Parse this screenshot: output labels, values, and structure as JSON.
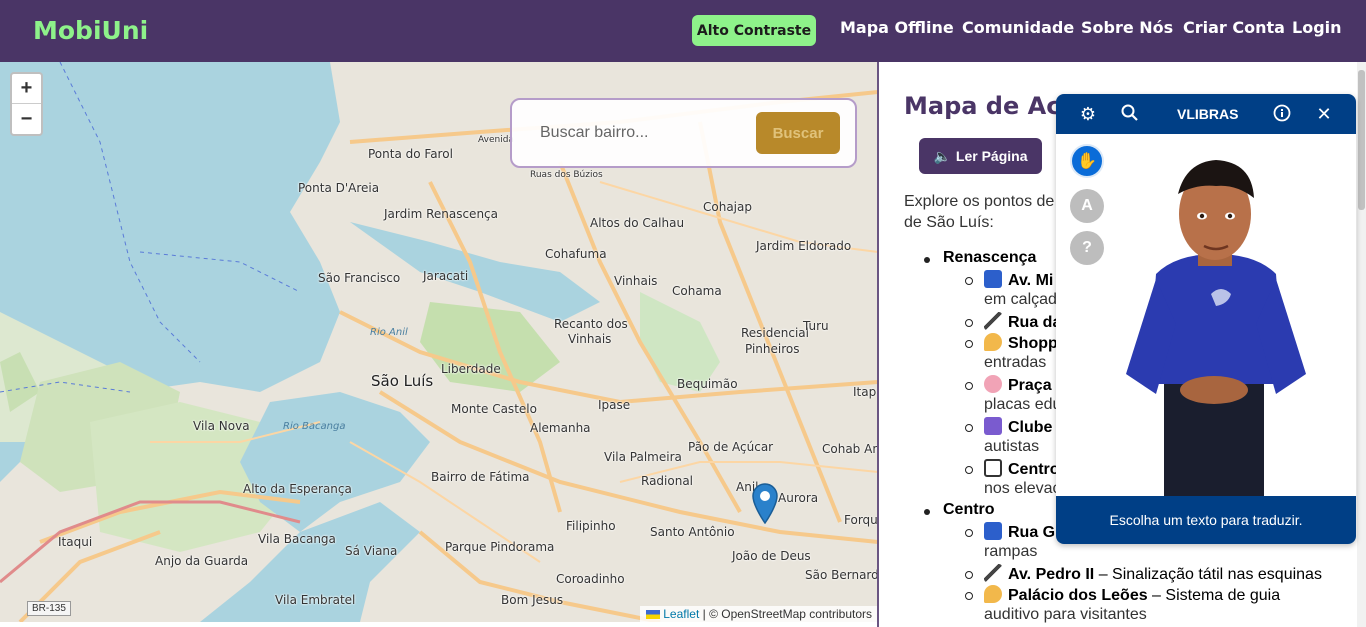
{
  "header": {
    "logo": "MobiUni",
    "contrast_button": "Alto Contraste",
    "nav": [
      "Mapa Offline",
      "Comunidade",
      "Sobre Nós",
      "Criar Conta",
      "Login"
    ]
  },
  "map": {
    "zoom_in": "+",
    "zoom_out": "−",
    "search_placeholder": "Buscar bairro...",
    "search_button": "Buscar",
    "attribution_link": "Leaflet",
    "attribution_text": "| © OpenStreetMap contributors",
    "route_sign": "BR-135",
    "labels": [
      "Ponta do Farol",
      "Ponta D'Areia",
      "Jardim Renascença",
      "Altos do Calhau",
      "Cohajap",
      "Jardim Eldorado",
      "Cohafuma",
      "São Francisco",
      "Jaracati",
      "Vinhais",
      "Cohama",
      "Recanto dos",
      "Vinhais",
      "Residencial",
      "Pinheiros",
      "Turu",
      "São Luís",
      "Liberdade",
      "Bequimão",
      "Monte Castelo",
      "Ipase",
      "Vila Nova",
      "Alemanha",
      "Pão de Açúcar",
      "Cohab Ane",
      "Vila Palmeira",
      "Alto da Esperança",
      "Bairro de Fátima",
      "Radional",
      "Anil",
      "Aurora",
      "Itaqui",
      "Vila Bacanga",
      "Filipinho",
      "Santo Antônio",
      "Forqu",
      "Anjo da Guarda",
      "Sá Viana",
      "Parque Pindorama",
      "João de Deus",
      "Coroadinho",
      "São Bernardo",
      "Vila Embratel",
      "Bom Jesus",
      "Itap",
      "Ruas dos Búzios",
      "Avenida",
      "Rio Anil",
      "Rio Bacanga"
    ],
    "primary_color": "#4a3566",
    "accent_color": "#8ef28a"
  },
  "content": {
    "title": "Mapa de Acessibilidade",
    "read_button": "Ler Página",
    "intro_line1": "Explore os pontos de acessibilidade nos bairros",
    "intro_line2": "de São Luís:",
    "sections": [
      {
        "name": "Renascença",
        "items": [
          {
            "title": "Av. Mi",
            "rest": "",
            "cont": "em calçada"
          },
          {
            "title": "Rua da",
            "rest": "",
            "cont": ""
          },
          {
            "title": "Shoppi",
            "rest": "",
            "cont": "entradas"
          },
          {
            "title": "Praça",
            "rest": "",
            "cont": "placas edu"
          },
          {
            "title": "Clube",
            "rest": "",
            "cont": "autistas"
          },
          {
            "title": "Centro",
            "rest": "",
            "cont": "nos elevac"
          }
        ]
      },
      {
        "name": "Centro",
        "items": [
          {
            "title": "Rua G",
            "rest": "",
            "cont": "rampas"
          },
          {
            "title": "Av. Pedro II",
            "rest": " – Sinalização tátil nas esquinas",
            "cont": ""
          },
          {
            "title": "Palácio dos Leões",
            "rest": " – Sistema de guia",
            "cont": "auditivo para visitantes"
          }
        ]
      }
    ]
  },
  "vlibras": {
    "title": "VLIBRAS",
    "footer": "Escolha um texto para traduzir.",
    "icons": [
      "gear-icon",
      "search-icon",
      "info-icon",
      "close-icon",
      "hand-icon",
      "translate-icon",
      "help-icon"
    ]
  }
}
